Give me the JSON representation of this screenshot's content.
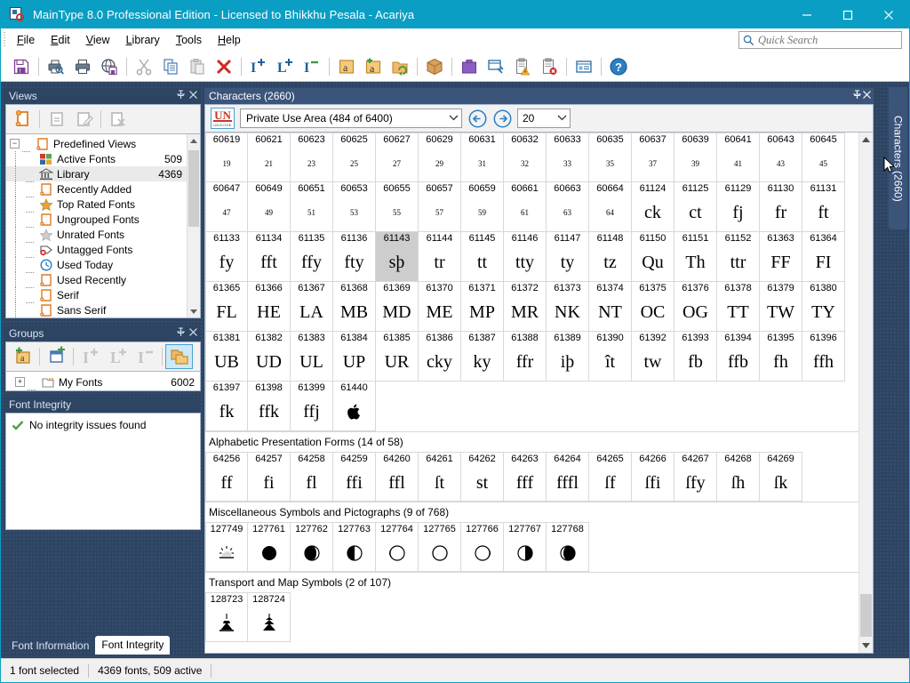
{
  "window": {
    "title": "MainType 8.0 Professional Edition - Licensed to Bhikkhu Pesala - Acariya",
    "minimize": "—",
    "maximize": "□",
    "close": "✕"
  },
  "menu": {
    "items": [
      {
        "label": "File",
        "accel": "F"
      },
      {
        "label": "Edit",
        "accel": "E"
      },
      {
        "label": "View",
        "accel": "V"
      },
      {
        "label": "Library",
        "accel": "L"
      },
      {
        "label": "Tools",
        "accel": "T"
      },
      {
        "label": "Help",
        "accel": "H"
      }
    ]
  },
  "search": {
    "placeholder": "Quick Search",
    "value": ""
  },
  "toolbar": {
    "buttons": [
      "save-font-icon",
      "print-preview-icon",
      "print-icon",
      "web-page-icon",
      "cut-icon",
      "copy-icon",
      "paste-icon",
      "delete-icon",
      "install-font-icon",
      "activate-font-icon",
      "deactivate-font-icon",
      "add-font-icon",
      "new-font-icon",
      "refresh-folder-icon",
      "package-icon",
      "briefcase-icon",
      "font-tools-icon",
      "report-warning-icon",
      "report-error-icon",
      "properties-icon",
      "help-icon"
    ]
  },
  "views": {
    "title": "Views",
    "pin": "📌",
    "close": "✕",
    "toolbar": [
      "new-view-icon",
      "view-details-icon",
      "edit-view-icon",
      "delete-view-icon"
    ],
    "root": {
      "label": "Predefined Views",
      "expander": "−"
    },
    "items": [
      {
        "label": "Active Fonts",
        "count": "509",
        "icon": "windows-squares-icon",
        "selected": false
      },
      {
        "label": "Library",
        "count": "4369",
        "icon": "bank-icon",
        "selected": true
      },
      {
        "label": "Recently Added",
        "count": "",
        "icon": "page-icon",
        "selected": false
      },
      {
        "label": "Top Rated Fonts",
        "count": "",
        "icon": "star-filled-icon",
        "selected": false
      },
      {
        "label": "Ungrouped Fonts",
        "count": "",
        "icon": "page-icon",
        "selected": false
      },
      {
        "label": "Unrated Fonts",
        "count": "",
        "icon": "star-grey-icon",
        "selected": false
      },
      {
        "label": "Untagged Fonts",
        "count": "",
        "icon": "tag-error-icon",
        "selected": false
      },
      {
        "label": "Used Today",
        "count": "",
        "icon": "clock-icon",
        "selected": false
      },
      {
        "label": "Used Recently",
        "count": "",
        "icon": "page-icon",
        "selected": false
      },
      {
        "label": "Serif",
        "count": "",
        "icon": "page-icon",
        "selected": false
      },
      {
        "label": "Sans Serif",
        "count": "",
        "icon": "page-icon",
        "selected": false
      }
    ]
  },
  "groups": {
    "title": "Groups",
    "pin": "📌",
    "close": "✕",
    "toolbar": [
      "new-group-icon",
      "new-folder-icon",
      "activate-icon",
      "activate-temp-icon",
      "deactivate-icon",
      "show-groups-icon"
    ],
    "items": [
      {
        "label": "My Fonts",
        "count": "6002",
        "expander": "+"
      }
    ]
  },
  "font_integrity": {
    "title": "Font Integrity",
    "message": "No integrity issues found",
    "check": "✔"
  },
  "left_tabs": [
    {
      "label": "Font Information",
      "active": false
    },
    {
      "label": "Font Integrity",
      "active": true
    }
  ],
  "characters": {
    "title": "Characters (2660)",
    "pin": "📌",
    "close": "✕",
    "vertical_tab": "Characters (2660)",
    "unicode_badge": {
      "big": "UN",
      "small": "UNICODE"
    },
    "range": "Private Use Area (484 of 6400)",
    "prev": "←",
    "next": "→",
    "size": "20",
    "sections": [
      {
        "title": "",
        "rows": [
          [
            {
              "code": "60619",
              "glyph": "19",
              "tiny": true
            },
            {
              "code": "60621",
              "glyph": "21",
              "tiny": true
            },
            {
              "code": "60623",
              "glyph": "23",
              "tiny": true
            },
            {
              "code": "60625",
              "glyph": "25",
              "tiny": true
            },
            {
              "code": "60627",
              "glyph": "27",
              "tiny": true
            },
            {
              "code": "60629",
              "glyph": "29",
              "tiny": true
            },
            {
              "code": "60631",
              "glyph": "31",
              "tiny": true
            },
            {
              "code": "60632",
              "glyph": "32",
              "tiny": true
            },
            {
              "code": "60633",
              "glyph": "33",
              "tiny": true
            },
            {
              "code": "60635",
              "glyph": "35",
              "tiny": true
            },
            {
              "code": "60637",
              "glyph": "37",
              "tiny": true
            },
            {
              "code": "60639",
              "glyph": "39",
              "tiny": true
            },
            {
              "code": "60641",
              "glyph": "41",
              "tiny": true
            },
            {
              "code": "60643",
              "glyph": "43",
              "tiny": true
            },
            {
              "code": "60645",
              "glyph": "45",
              "tiny": true
            }
          ],
          [
            {
              "code": "60647",
              "glyph": "47",
              "tiny": true
            },
            {
              "code": "60649",
              "glyph": "49",
              "tiny": true
            },
            {
              "code": "60651",
              "glyph": "51",
              "tiny": true
            },
            {
              "code": "60653",
              "glyph": "53",
              "tiny": true
            },
            {
              "code": "60655",
              "glyph": "55",
              "tiny": true
            },
            {
              "code": "60657",
              "glyph": "57",
              "tiny": true
            },
            {
              "code": "60659",
              "glyph": "59",
              "tiny": true
            },
            {
              "code": "60661",
              "glyph": "61",
              "tiny": true
            },
            {
              "code": "60663",
              "glyph": "63",
              "tiny": true
            },
            {
              "code": "60664",
              "glyph": "64",
              "tiny": true
            },
            {
              "code": "61124",
              "glyph": "ck"
            },
            {
              "code": "61125",
              "glyph": "ct"
            },
            {
              "code": "61129",
              "glyph": "fj"
            },
            {
              "code": "61130",
              "glyph": "fr"
            },
            {
              "code": "61131",
              "glyph": "ft"
            }
          ],
          [
            {
              "code": "61133",
              "glyph": "fy"
            },
            {
              "code": "61134",
              "glyph": "fft"
            },
            {
              "code": "61135",
              "glyph": "ffy"
            },
            {
              "code": "61136",
              "glyph": "fty"
            },
            {
              "code": "61143",
              "glyph": "sþ",
              "selected": true
            },
            {
              "code": "61144",
              "glyph": "tr"
            },
            {
              "code": "61145",
              "glyph": "tt"
            },
            {
              "code": "61146",
              "glyph": "tty"
            },
            {
              "code": "61147",
              "glyph": "ty"
            },
            {
              "code": "61148",
              "glyph": "tz"
            },
            {
              "code": "61150",
              "glyph": "Qu"
            },
            {
              "code": "61151",
              "glyph": "Th"
            },
            {
              "code": "61152",
              "glyph": "ttr"
            },
            {
              "code": "61363",
              "glyph": "FF"
            },
            {
              "code": "61364",
              "glyph": "FI"
            }
          ],
          [
            {
              "code": "61365",
              "glyph": "FL"
            },
            {
              "code": "61366",
              "glyph": "HE"
            },
            {
              "code": "61367",
              "glyph": "LA"
            },
            {
              "code": "61368",
              "glyph": "MB"
            },
            {
              "code": "61369",
              "glyph": "MD"
            },
            {
              "code": "61370",
              "glyph": "ME"
            },
            {
              "code": "61371",
              "glyph": "MP"
            },
            {
              "code": "61372",
              "glyph": "MR"
            },
            {
              "code": "61373",
              "glyph": "NK"
            },
            {
              "code": "61374",
              "glyph": "NT"
            },
            {
              "code": "61375",
              "glyph": "OC"
            },
            {
              "code": "61376",
              "glyph": "OG"
            },
            {
              "code": "61378",
              "glyph": "TT"
            },
            {
              "code": "61379",
              "glyph": "TW"
            },
            {
              "code": "61380",
              "glyph": "TY"
            }
          ],
          [
            {
              "code": "61381",
              "glyph": "UB"
            },
            {
              "code": "61382",
              "glyph": "UD"
            },
            {
              "code": "61383",
              "glyph": "UL"
            },
            {
              "code": "61384",
              "glyph": "UP"
            },
            {
              "code": "61385",
              "glyph": "UR"
            },
            {
              "code": "61386",
              "glyph": "cky"
            },
            {
              "code": "61387",
              "glyph": "ky"
            },
            {
              "code": "61388",
              "glyph": "ffr"
            },
            {
              "code": "61389",
              "glyph": "iþ"
            },
            {
              "code": "61390",
              "glyph": "ît"
            },
            {
              "code": "61392",
              "glyph": "tw"
            },
            {
              "code": "61393",
              "glyph": "fb"
            },
            {
              "code": "61394",
              "glyph": "ffb"
            },
            {
              "code": "61395",
              "glyph": "fh"
            },
            {
              "code": "61396",
              "glyph": "ffh"
            }
          ],
          [
            {
              "code": "61397",
              "glyph": "fk"
            },
            {
              "code": "61398",
              "glyph": "ffk"
            },
            {
              "code": "61399",
              "glyph": "ffj"
            },
            {
              "code": "61440",
              "glyph": "",
              "icon": "apple-logo-icon"
            }
          ]
        ]
      },
      {
        "title": "Alphabetic Presentation Forms (14 of 58)",
        "rows": [
          [
            {
              "code": "64256",
              "glyph": "ff"
            },
            {
              "code": "64257",
              "glyph": "fi"
            },
            {
              "code": "64258",
              "glyph": "fl"
            },
            {
              "code": "64259",
              "glyph": "ffi"
            },
            {
              "code": "64260",
              "glyph": "ffl"
            },
            {
              "code": "64261",
              "glyph": "ſt"
            },
            {
              "code": "64262",
              "glyph": "st"
            },
            {
              "code": "64263",
              "glyph": "fff"
            },
            {
              "code": "64264",
              "glyph": "fffl"
            },
            {
              "code": "64265",
              "glyph": "ſf"
            },
            {
              "code": "64266",
              "glyph": "ſfi"
            },
            {
              "code": "64267",
              "glyph": "ſfy"
            },
            {
              "code": "64268",
              "glyph": "ſh"
            },
            {
              "code": "64269",
              "glyph": "ſk"
            }
          ]
        ]
      },
      {
        "title": "Miscellaneous Symbols and Pictographs (9 of 768)",
        "rows": [
          [
            {
              "code": "127749",
              "glyph": "",
              "icon": "sun-behind-cloud-icon"
            },
            {
              "code": "127761",
              "glyph": "",
              "icon": "new-moon-icon"
            },
            {
              "code": "127762",
              "glyph": "",
              "icon": "waxing-crescent-icon"
            },
            {
              "code": "127763",
              "glyph": "",
              "icon": "first-quarter-moon-icon"
            },
            {
              "code": "127764",
              "glyph": "",
              "icon": "waxing-gibbous-icon"
            },
            {
              "code": "127765",
              "glyph": "",
              "icon": "full-moon-icon"
            },
            {
              "code": "127766",
              "glyph": "",
              "icon": "waning-gibbous-icon"
            },
            {
              "code": "127767",
              "glyph": "",
              "icon": "last-quarter-moon-icon"
            },
            {
              "code": "127768",
              "glyph": "",
              "icon": "waning-crescent-icon"
            }
          ]
        ]
      },
      {
        "title": "Transport and Map Symbols (2 of 107)",
        "rows": [
          [
            {
              "code": "128723",
              "glyph": "",
              "icon": "mountain-shrine-icon"
            },
            {
              "code": "128724",
              "glyph": "",
              "icon": "pagoda-icon"
            }
          ]
        ]
      }
    ]
  },
  "statusbar": {
    "selection": "1 font selected",
    "counts": "4369 fonts, 509 active"
  },
  "colors": {
    "accent": "#0a9ec4",
    "panel_bg": "#2e4463",
    "panel_head": "#3b547a",
    "selection": "#cdcdcd",
    "tree_selection": "#eaeaea"
  }
}
